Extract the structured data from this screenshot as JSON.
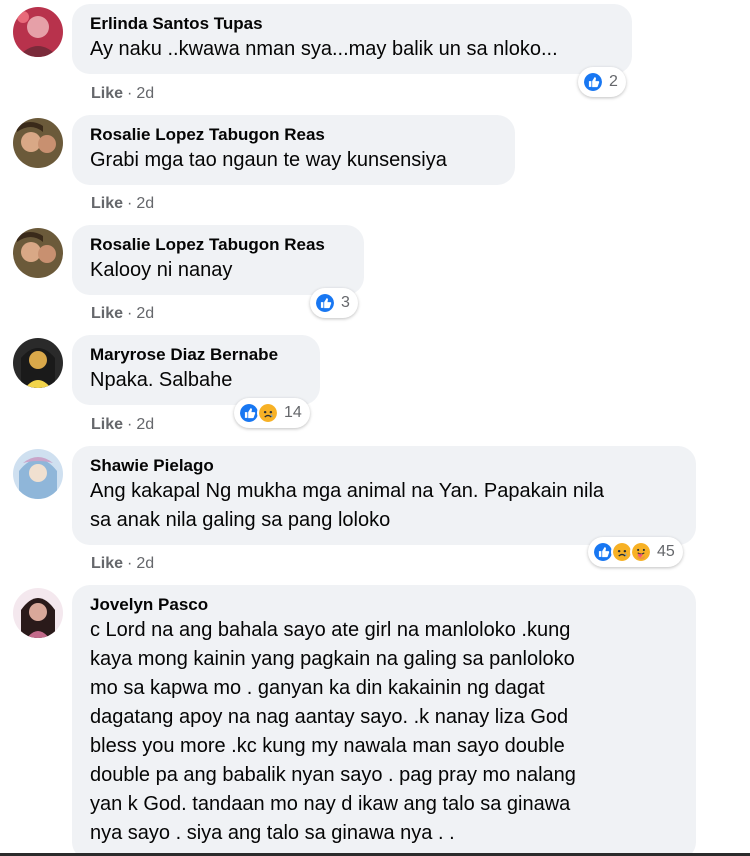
{
  "comments": [
    {
      "author": "Erlinda Santos Tupas",
      "text": "Ay naku ..kwawa nman sya...may balik un sa nloko...",
      "like_label": "Like",
      "time": "2d",
      "reaction_count": "2",
      "reactions": [
        "like-icon"
      ],
      "avatar_colors": [
        "#c23a54",
        "#7a2a3a",
        "#e6a0a8"
      ]
    },
    {
      "author": "Rosalie Lopez Tabugon Reas",
      "text": "Grabi mga tao ngaun te way kunsensiya",
      "like_label": "Like",
      "time": "2d",
      "avatar_colors": [
        "#6b5a3a",
        "#d9a886",
        "#3a2a1a"
      ]
    },
    {
      "author": "Rosalie Lopez Tabugon Reas",
      "text": "Kalooy ni nanay",
      "like_label": "Like",
      "time": "2d",
      "reaction_count": "3",
      "reactions": [
        "like-icon"
      ],
      "avatar_colors": [
        "#6b5a3a",
        "#d9a886",
        "#3a2a1a"
      ]
    },
    {
      "author": "Maryrose Diaz Bernabe",
      "text": "Npaka. Salbahe",
      "like_label": "Like",
      "time": "2d",
      "reaction_count": "14",
      "reactions": [
        "like-icon",
        "sad-icon"
      ],
      "avatar_colors": [
        "#1a1a1a",
        "#d9a84a",
        "#f2d44a"
      ]
    },
    {
      "author": "Shawie Pielago",
      "text": "Ang kakapal Ng mukha mga animal na Yan. Papakain nila\nsa anak nila galing sa pang loloko",
      "like_label": "Like",
      "time": "2d",
      "reaction_count": "45",
      "reactions": [
        "like-icon",
        "sad-icon",
        "care-icon"
      ],
      "avatar_colors": [
        "#8fb6d9",
        "#c9a4c9",
        "#f0e0d0"
      ]
    },
    {
      "author": "Jovelyn Pasco",
      "text": "c Lord na ang bahala sayo ate girl na manloloko .kung\nkaya mong kainin yang pagkain na galing sa panloloko\nmo sa kapwa mo . ganyan ka din kakainin ng dagat\ndagatang apoy na nag aantay sayo. .k nanay liza God\nbless you more .kc kung my nawala man sayo double\ndouble pa ang babalik nyan sayo . pag pray mo nalang\nyan k God. tandaan mo nay d ikaw ang talo sa ginawa\nnya sayo . siya ang talo sa ginawa nya . .",
      "avatar_colors": [
        "#2a1a1a",
        "#d9a89a",
        "#c26a8a"
      ]
    }
  ],
  "colors": {
    "bubble": "#f0f2f5",
    "meta_text": "#65676b",
    "like_blue": "#1877f2",
    "sad_yellow": "#f7b125",
    "care_orange": "#f0973c"
  }
}
